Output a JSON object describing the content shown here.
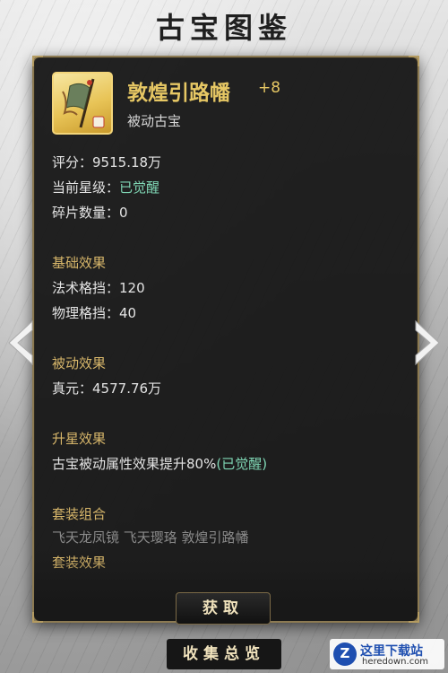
{
  "page_title": "古宝图鉴",
  "item": {
    "name": "敦煌引路幡",
    "level": "+8",
    "type": "被动古宝",
    "icon": "banner-artifact-icon"
  },
  "stats": {
    "rating_label": "评分：",
    "rating_value": "9515.18万",
    "star_label": "当前星级：",
    "star_value": "已觉醒",
    "shards_label": "碎片数量：",
    "shards_value": "0"
  },
  "basic_effects": {
    "title": "基础效果",
    "rows": [
      {
        "label": "法术格挡：",
        "value": "120"
      },
      {
        "label": "物理格挡：",
        "value": "40"
      }
    ]
  },
  "passive_effects": {
    "title": "被动效果",
    "rows": [
      {
        "label": "真元：",
        "value": "4577.76万"
      }
    ]
  },
  "star_effects": {
    "title": "升星效果",
    "text": "古宝被动属性效果提升80%",
    "status": "(已觉醒)"
  },
  "set_combo": {
    "title": "套装组合",
    "items": "飞天龙凤镜 飞天璎珞 敦煌引路幡"
  },
  "set_effects": {
    "title": "套装效果"
  },
  "buttons": {
    "get": "获取",
    "collection": "收集总览"
  },
  "watermark": {
    "title": "这里下载站",
    "url": "heredown.com"
  },
  "colors": {
    "gold": "#e6c764",
    "green": "#7fd6b4",
    "section": "#d7b66a",
    "border": "#8c7a52"
  }
}
